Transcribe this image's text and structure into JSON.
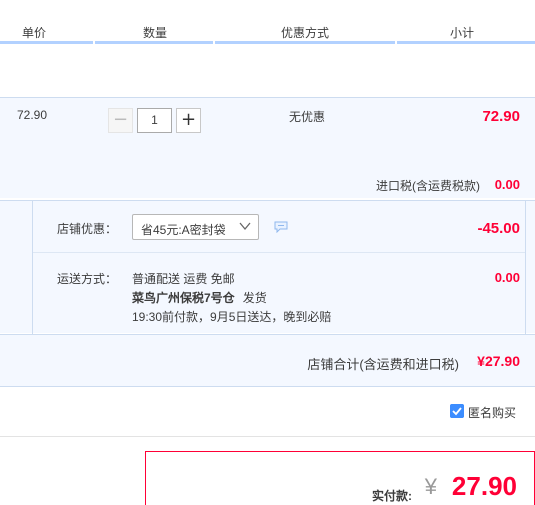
{
  "header": {
    "col_price": "单价",
    "col_qty": "数量",
    "col_promo": "优惠方式",
    "col_subtotal": "小计"
  },
  "item": {
    "price": "72.90",
    "quantity": "1",
    "promo": "无优惠",
    "subtotal": "72.90",
    "tax_label": "进口税(含运费税款)",
    "tax_value": "0.00"
  },
  "shop": {
    "discount_label": "店铺优惠：",
    "discount_selected": "省45元:A密封袋",
    "discount_value": "-45.00",
    "shipping_label": "运送方式：",
    "shipping_line1": "普通配送 运费 免邮",
    "shipping_warehouse": "菜鸟广州保税7号仓",
    "shipping_dispatch": "发货",
    "shipping_line3": "19:30前付款，9月5日送达，晚到必赔",
    "shipping_fee": "0.00"
  },
  "total": {
    "label": "店铺合计(含运费和进口税)",
    "value": "¥27.90"
  },
  "anonymous": {
    "label": "匿名购买",
    "checked": true
  },
  "payment": {
    "label": "实付款:",
    "currency": "¥",
    "amount": "27.90"
  },
  "colors": {
    "accent_red": "#ff0036",
    "header_bar": "#b2d1ff",
    "row_bg": "#f4f8ff",
    "checkbox": "#3c8dff"
  }
}
